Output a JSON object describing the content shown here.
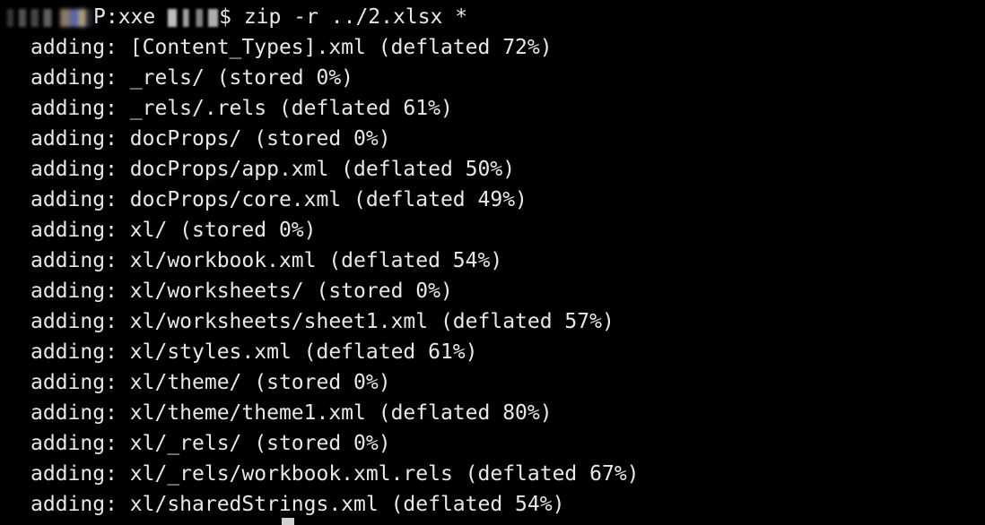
{
  "terminal": {
    "prompt": {
      "visible_host_fragment": "P:xxe",
      "prompt_symbol": "$",
      "command": "zip -r ../2.xlsx *"
    },
    "output_lines": [
      "adding: [Content_Types].xml (deflated 72%)",
      "adding: _rels/ (stored 0%)",
      "adding: _rels/.rels (deflated 61%)",
      "adding: docProps/ (stored 0%)",
      "adding: docProps/app.xml (deflated 50%)",
      "adding: docProps/core.xml (deflated 49%)",
      "adding: xl/ (stored 0%)",
      "adding: xl/workbook.xml (deflated 54%)",
      "adding: xl/worksheets/ (stored 0%)",
      "adding: xl/worksheets/sheet1.xml (deflated 57%)",
      "adding: xl/styles.xml (deflated 61%)",
      "adding: xl/theme/ (stored 0%)",
      "adding: xl/theme/theme1.xml (deflated 80%)",
      "adding: xl/_rels/ (stored 0%)",
      "adding: xl/_rels/workbook.xml.rels (deflated 67%)",
      "adding: xl/sharedStrings.xml (deflated 54%)"
    ],
    "colors": {
      "background": "#000000",
      "text": "#e8e8e8",
      "cursor": "#d0d0d0"
    }
  }
}
